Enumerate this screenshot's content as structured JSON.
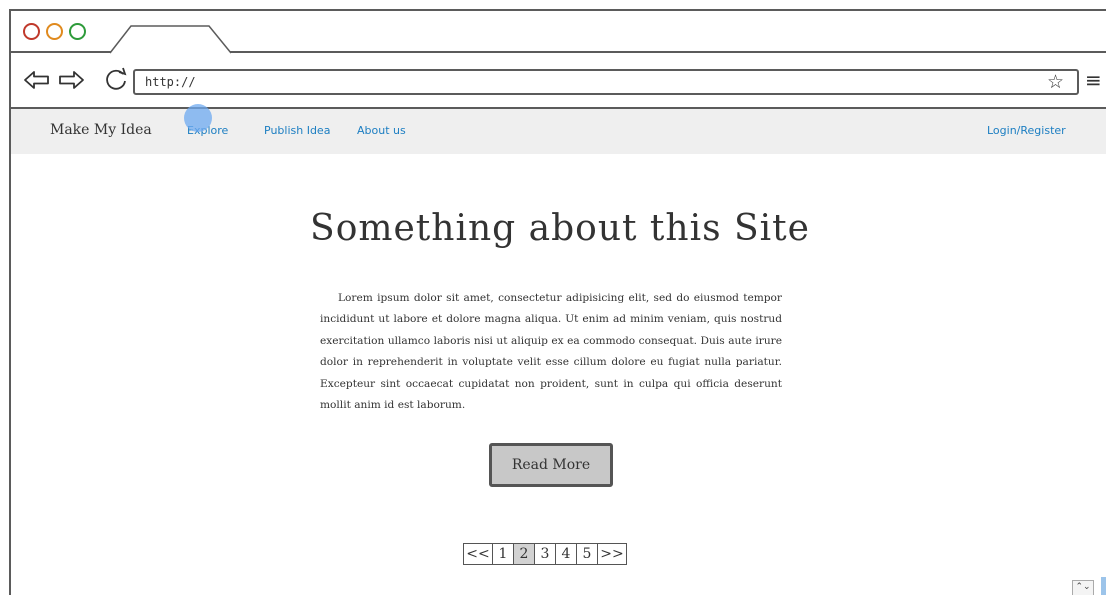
{
  "browser": {
    "url": "http://",
    "star_glyph": "☆",
    "menu_glyph": "≡"
  },
  "nav": {
    "brand": "Make My Idea",
    "links": [
      "Explore",
      "Publish Idea",
      "About us"
    ],
    "login": "Login/Register",
    "link_color": "#1c7ec2"
  },
  "content": {
    "heading": "Something about this Site",
    "paragraph": "Lorem ipsum dolor sit amet, consectetur adipisicing elit, sed do eiusmod tempor incididunt ut labore et dolore magna aliqua. Ut enim ad minim veniam, quis nostrud exercitation ullamco laboris nisi ut aliquip ex ea commodo consequat. Duis aute irure dolor in reprehenderit in voluptate velit esse cillum dolore eu fugiat nulla pariatur. Excepteur sint occaecat cupidatat non proident, sunt in culpa qui officia deserunt mollit anim id est laborum.",
    "button": "Read More"
  },
  "pagination": {
    "items": [
      "<<",
      "1",
      "2",
      "3",
      "4",
      "5",
      ">>"
    ],
    "active": "2"
  },
  "resize_glyph": "⌃⌄"
}
